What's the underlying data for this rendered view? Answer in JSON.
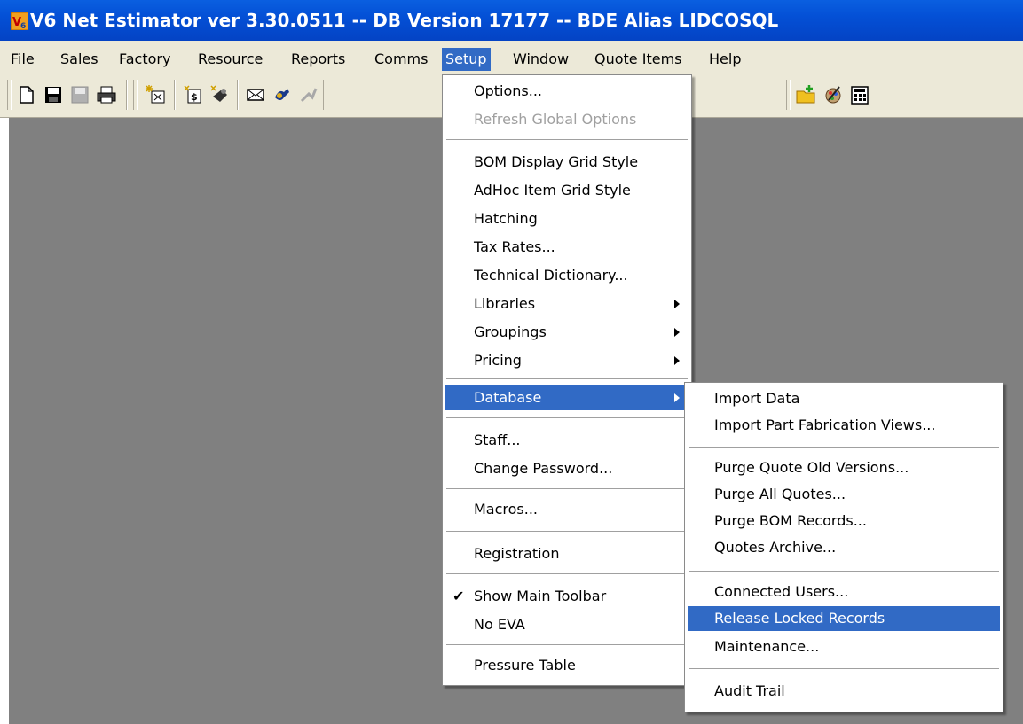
{
  "window": {
    "title": "V6 Net Estimator ver 3.30.0511 -- DB Version 17177 -- BDE Alias LIDCOSQL",
    "app_icon": "v6-app-icon",
    "title_bar_color": "#0450d6",
    "menu_highlight_color": "#316ac5",
    "workspace_color": "#808080"
  },
  "menubar": {
    "items": [
      "File",
      "Sales",
      "Factory",
      "Resource",
      "Reports",
      "Comms",
      "Setup",
      "Window",
      "Quote Items",
      "Help"
    ],
    "active": "Setup"
  },
  "toolbar": {
    "buttons": [
      "new-document-icon",
      "save-icon",
      "save-disabled-icon",
      "print-icon",
      "new-quote-icon",
      "new-costing-icon",
      "email-icon",
      "connect-icon",
      "disconnect-icon",
      "new-folder-icon",
      "tools-icon",
      "calculator-icon"
    ]
  },
  "setup_menu": {
    "options": "Options...",
    "refresh_global_options": "Refresh Global Options",
    "bom_display_grid_style": "BOM Display Grid Style",
    "adhoc_item_grid_style": "AdHoc Item Grid Style",
    "hatching": "Hatching",
    "tax_rates": "Tax Rates...",
    "technical_dictionary": "Technical Dictionary...",
    "libraries": "Libraries",
    "groupings": "Groupings",
    "pricing": "Pricing",
    "database": "Database",
    "staff": "Staff...",
    "change_password": "Change Password...",
    "macros": "Macros...",
    "registration": "Registration",
    "show_main_toolbar": "Show Main Toolbar",
    "show_main_toolbar_checked": true,
    "no_eva": "No EVA",
    "pressure_table": "Pressure Table"
  },
  "database_submenu": {
    "import_data": "Import Data",
    "import_part_fabrication_views": "Import Part Fabrication Views...",
    "purge_quote_old_versions": "Purge Quote Old Versions...",
    "purge_all_quotes": "Purge All Quotes...",
    "purge_bom_records": "Purge BOM Records...",
    "quotes_archive": "Quotes Archive...",
    "connected_users": "Connected Users...",
    "release_locked_records": "Release Locked Records",
    "maintenance": "Maintenance...",
    "audit_trail": "Audit Trail"
  }
}
